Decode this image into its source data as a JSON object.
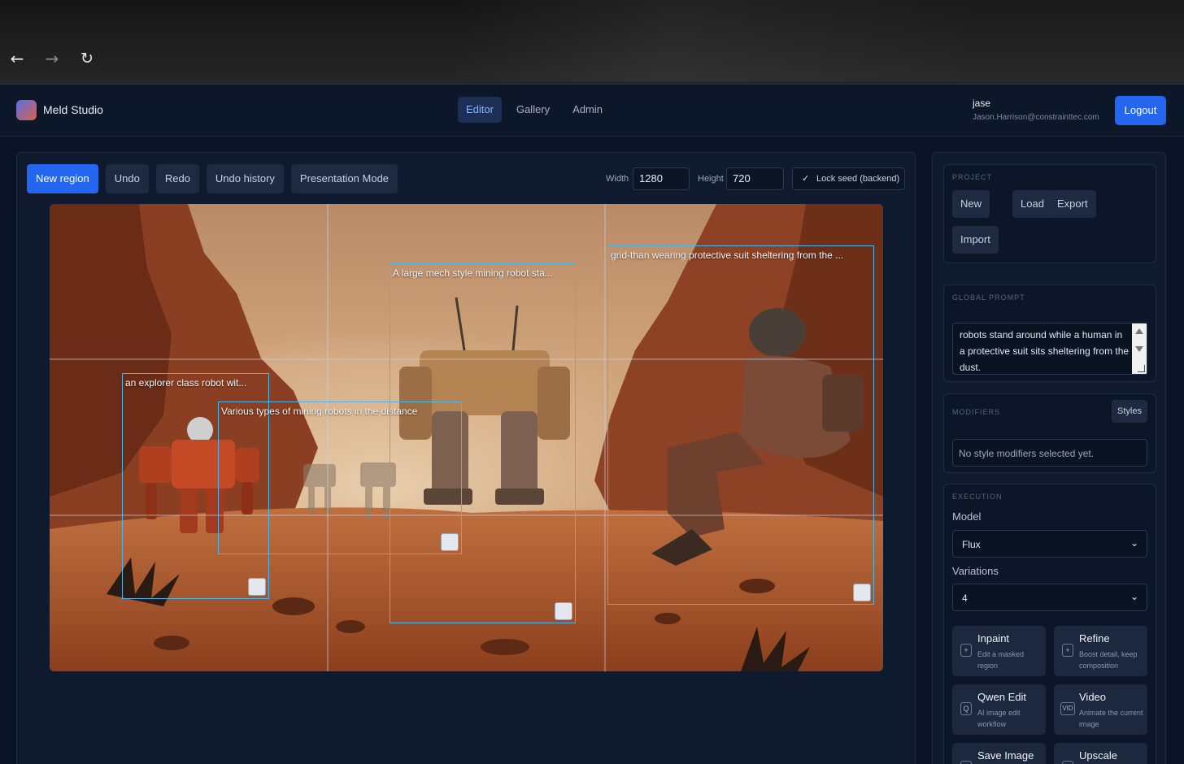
{
  "browser": {
    "back_icon": "←",
    "forward_icon": "→",
    "reload_icon": "↻"
  },
  "header": {
    "brand": "Meld Studio",
    "tabs": [
      {
        "label": "Editor",
        "active": true
      },
      {
        "label": "Gallery",
        "active": false
      },
      {
        "label": "Admin",
        "active": false
      }
    ],
    "user": {
      "name": "jase",
      "email": "Jason.Harrison@constrainttec.com"
    },
    "logout_label": "Logout"
  },
  "toolbar": {
    "new_region": "New region",
    "undo": "Undo",
    "redo": "Redo",
    "undo_history": "Undo history",
    "presentation_mode": "Presentation Mode",
    "width_label": "Width",
    "width_value": "1280",
    "height_label": "Height",
    "height_value": "720",
    "lock_seed_label": "Lock seed (backend)",
    "lock_seed_checked": true
  },
  "regions": [
    {
      "label": "an explorer class robot wit..."
    },
    {
      "label": "Various types of mining robots in the distance"
    },
    {
      "label": "A large mech style mining robot sta..."
    },
    {
      "label": "grid-than wearing protective suit sheltering from the ..."
    }
  ],
  "project": {
    "title": "PROJECT",
    "new": "New",
    "load": "Load",
    "export": "Export",
    "import": "Import"
  },
  "global_prompt": {
    "title": "GLOBAL PROMPT",
    "text": "robots stand around while a human in a protective suit sits sheltering from the dust."
  },
  "modifiers": {
    "title": "MODIFIERS",
    "styles_label": "Styles",
    "empty_text": "No style modifiers selected yet."
  },
  "execution": {
    "title": "EXECUTION",
    "model_label": "Model",
    "model_value": "Flux",
    "variations_label": "Variations",
    "variations_value": "4",
    "actions": [
      {
        "icon": "+",
        "title": "Inpaint",
        "desc": "Edit a masked region"
      },
      {
        "icon": "+",
        "title": "Refine",
        "desc": "Boost detail, keep composition"
      },
      {
        "icon": "Q",
        "title": "Qwen Edit",
        "desc": "AI image edit workflow"
      },
      {
        "icon": "VID",
        "title": "Video",
        "desc": "Animate the current image"
      },
      {
        "icon": "",
        "title": "Save Image",
        "desc": ""
      },
      {
        "icon": "",
        "title": "Upscale",
        "desc": ""
      }
    ]
  }
}
